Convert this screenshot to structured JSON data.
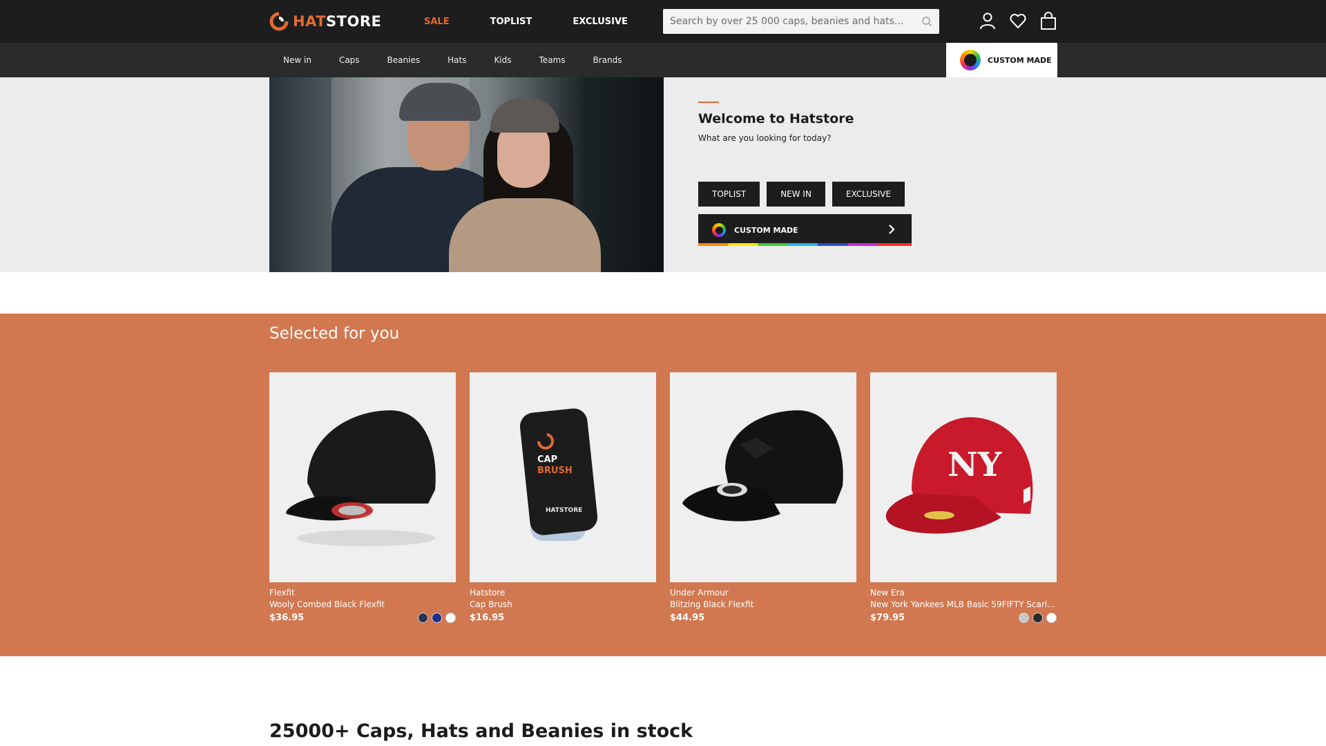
{
  "header": {
    "logo": {
      "part1": "HAT",
      "part2": "STORE"
    },
    "main_nav": [
      {
        "label": "SALE"
      },
      {
        "label": "TOPLIST"
      },
      {
        "label": "EXCLUSIVE"
      }
    ],
    "search": {
      "placeholder": "Search by over 25 000 caps, beanies and hats..."
    },
    "icons": [
      "user-icon",
      "heart-icon",
      "bag-icon"
    ]
  },
  "subnav": {
    "items": [
      {
        "label": "New in"
      },
      {
        "label": "Caps"
      },
      {
        "label": "Beanies"
      },
      {
        "label": "Hats"
      },
      {
        "label": "Kids"
      },
      {
        "label": "Teams"
      },
      {
        "label": "Brands"
      }
    ],
    "custom_made": "CUSTOM MADE"
  },
  "hero": {
    "title": "Welcome to Hatstore",
    "subtitle": "What are you looking for today?",
    "buttons": [
      {
        "label": "TOPLIST"
      },
      {
        "label": "NEW IN"
      },
      {
        "label": "EXCLUSIVE"
      }
    ],
    "custom_made": "CUSTOM MADE"
  },
  "selected": {
    "title": "Selected for you",
    "products": [
      {
        "brand": "Flexfit",
        "name": "Wooly Combed Black Flexfit",
        "price": "$36.95",
        "image": "black-flexfit-cap",
        "swatches": [
          "#2b3550",
          "#1f2f8c",
          "#ffffff"
        ]
      },
      {
        "brand": "Hatstore",
        "name": "Cap Brush",
        "price": "$16.95",
        "image": "cap-brush",
        "swatches": []
      },
      {
        "brand": "Under Armour",
        "name": "Blitzing Black Flexfit",
        "price": "$44.95",
        "image": "black-under-armour-cap",
        "swatches": []
      },
      {
        "brand": "New Era",
        "name": "New York Yankees MLB Basic 59FIFTY Scarl...",
        "price": "$79.95",
        "image": "red-yankees-cap",
        "swatches": [
          "#c9c9c9",
          "#2a2a2a",
          "#ffffff"
        ]
      }
    ]
  },
  "bottom": {
    "title": "25000+ Caps, Hats and Beanies in stock"
  },
  "colors": {
    "accent": "#e26a32",
    "topbar": "#1d1d1d",
    "subbar": "#2b2b2b",
    "hero_bg": "#ececec",
    "selected_bg": "#d17850"
  }
}
